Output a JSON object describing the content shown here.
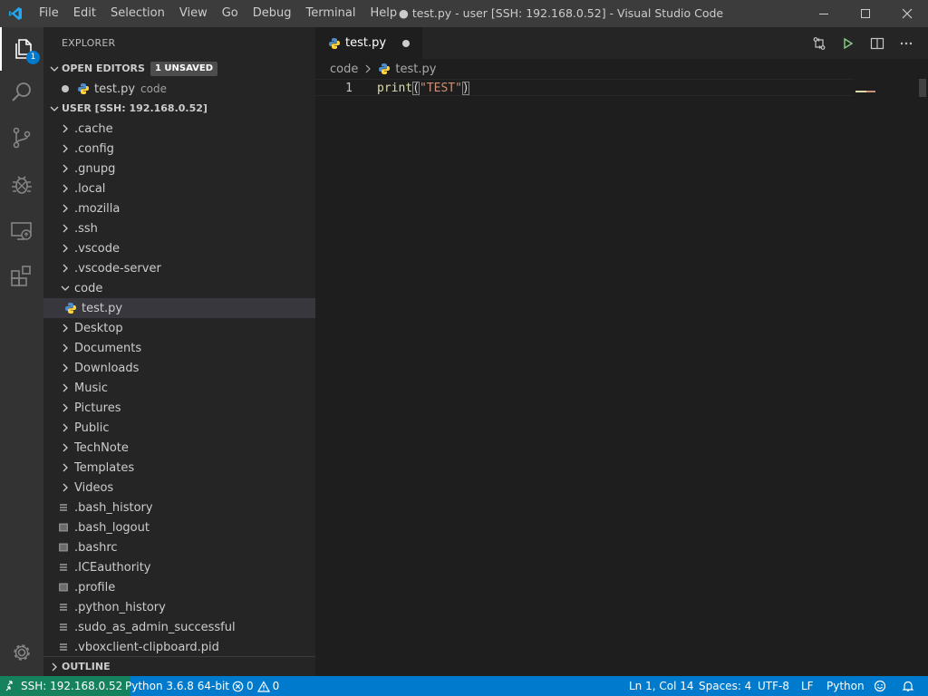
{
  "window": {
    "title": "● test.py - user [SSH: 192.168.0.52] - Visual Studio Code",
    "menu": [
      "File",
      "Edit",
      "Selection",
      "View",
      "Go",
      "Debug",
      "Terminal",
      "Help"
    ]
  },
  "activity_bar": {
    "explorer_badge": "1",
    "items": [
      "files-icon",
      "search-icon",
      "source-control-icon",
      "debug-icon",
      "remote-explorer-icon",
      "extensions-icon"
    ],
    "bottom": "gear-icon"
  },
  "sidebar": {
    "title": "EXPLORER",
    "open_editors": {
      "header": "OPEN EDITORS",
      "unsaved_badge": "1 UNSAVED",
      "items": [
        {
          "name": "test.py",
          "description": "code"
        }
      ]
    },
    "workspace": {
      "header": "USER [SSH: 192.168.0.52]",
      "folders_before": [
        ".cache",
        ".config",
        ".gnupg",
        ".local",
        ".mozilla",
        ".ssh",
        ".vscode",
        ".vscode-server"
      ],
      "expanded_folder": "code",
      "child_file": "test.py",
      "folders_after": [
        "Desktop",
        "Documents",
        "Downloads",
        "Music",
        "Pictures",
        "Public",
        "TechNote",
        "Templates",
        "Videos"
      ],
      "files": [
        ".bash_history",
        ".bash_logout",
        ".bashrc",
        ".ICEauthority",
        ".profile",
        ".python_history",
        ".sudo_as_admin_successful",
        ".vboxclient-clipboard.pid"
      ]
    },
    "outline": "OUTLINE"
  },
  "editor": {
    "tab": {
      "label": "test.py",
      "dirty": true
    },
    "breadcrumbs": [
      "code",
      "test.py"
    ],
    "lines": [
      {
        "number": "1",
        "fn": "print",
        "open": "(",
        "str": "\"TEST\"",
        "close": ")"
      }
    ]
  },
  "status_bar": {
    "remote": "SSH: 192.168.0.52",
    "interpreter": "Python 3.6.8 64-bit",
    "errors": "0",
    "warnings": "0",
    "position": "Ln 1, Col 14",
    "spaces": "Spaces: 4",
    "encoding": "UTF-8",
    "eol": "LF",
    "language": "Python"
  },
  "colors": {
    "accent": "#007acc",
    "remote": "#16825d",
    "python_blue": "#4f8cc9",
    "python_yellow": "#ffd43b"
  }
}
